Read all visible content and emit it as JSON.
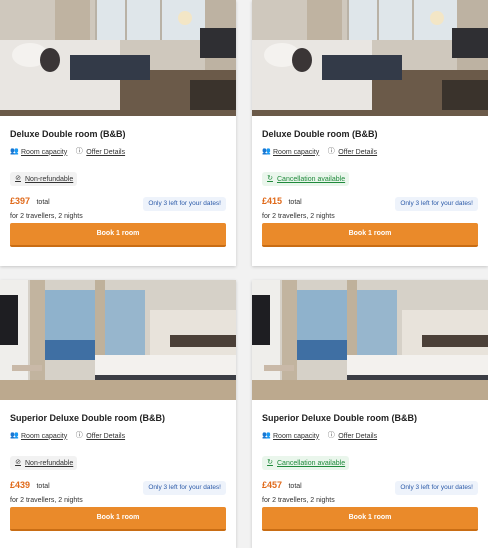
{
  "cards": [
    {
      "title": "Deluxe Double room (B&B)",
      "room_capacity_label": "Room capacity",
      "offer_details_label": "Offer Details",
      "policy": "Non-refundable",
      "policy_type": "nonref",
      "price": "£397",
      "total_label": "total",
      "travellers": "for 2 travellers, 2 nights",
      "availability": "Only 3 left for your dates!",
      "book_label": "Book 1 room"
    },
    {
      "title": "Deluxe Double room (B&B)",
      "room_capacity_label": "Room capacity",
      "offer_details_label": "Offer Details",
      "policy": "Cancellation available",
      "policy_type": "cancel",
      "price": "£415",
      "total_label": "total",
      "travellers": "for 2 travellers, 2 nights",
      "availability": "Only 3 left for your dates!",
      "book_label": "Book 1 room"
    },
    {
      "title": "Superior Deluxe Double room (B&B)",
      "room_capacity_label": "Room capacity",
      "offer_details_label": "Offer Details",
      "policy": "Non-refundable",
      "policy_type": "nonref",
      "price": "£439",
      "total_label": "total",
      "travellers": "for 2 travellers, 2 nights",
      "availability": "Only 3 left for your dates!",
      "book_label": "Book 1 room"
    },
    {
      "title": "Superior Deluxe Double room (B&B)",
      "room_capacity_label": "Room capacity",
      "offer_details_label": "Offer Details",
      "policy": "Cancellation available",
      "policy_type": "cancel",
      "price": "£457",
      "total_label": "total",
      "travellers": "for 2 travellers, 2 nights",
      "availability": "Only 3 left for your dates!",
      "book_label": "Book 1 room"
    }
  ],
  "colors": {
    "accent": "#ea8a2a",
    "price": "#e06a1b",
    "cancel_green": "#1f8a3b",
    "badge_blue": "#2b5aa8"
  },
  "icons": {
    "room_capacity": "people-icon",
    "offer_details": "info-icon",
    "non_refundable": "no-refund-icon",
    "cancellation": "refresh-check-icon"
  }
}
